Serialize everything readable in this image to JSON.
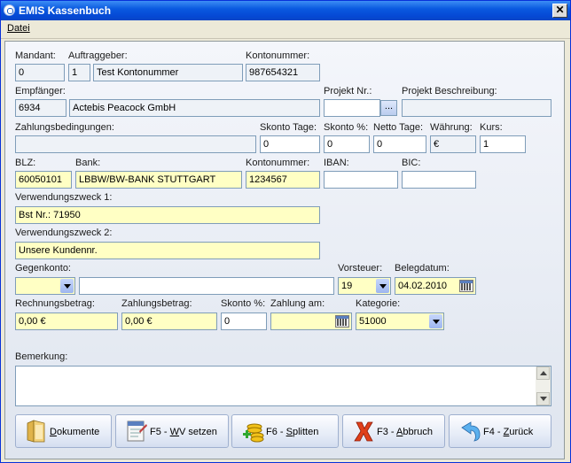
{
  "window": {
    "title": "EMIS Kassenbuch",
    "close": "✕"
  },
  "menu": {
    "datei": "Datei"
  },
  "labels": {
    "mandant": "Mandant:",
    "auftraggeber": "Auftraggeber:",
    "kontonummer1": "Kontonummer:",
    "empfaenger": "Empfänger:",
    "projekt_nr": "Projekt Nr.:",
    "projekt_beschreibung": "Projekt Beschreibung:",
    "zahlungsbedingungen": "Zahlungsbedingungen:",
    "skonto_tage": "Skonto Tage:",
    "skonto_pct": "Skonto %:",
    "netto_tage": "Netto Tage:",
    "waehrung": "Währung:",
    "kurs": "Kurs:",
    "blz": "BLZ:",
    "bank": "Bank:",
    "kontonummer2": "Kontonummer:",
    "iban": "IBAN:",
    "bic": "BIC:",
    "vz1": "Verwendungszweck 1:",
    "vz2": "Verwendungszweck 2:",
    "gegenkonto": "Gegenkonto:",
    "vorsteuer": "Vorsteuer:",
    "belegdatum": "Belegdatum:",
    "rechnungsbetrag": "Rechnungsbetrag:",
    "zahlungsbetrag": "Zahlungsbetrag:",
    "skonto_pct2": "Skonto %:",
    "zahlung_am": "Zahlung am:",
    "kategorie": "Kategorie:",
    "bemerkung": "Bemerkung:"
  },
  "values": {
    "mandant": "0",
    "auftraggeber_nr": "1",
    "auftraggeber_name": "Test Kontonummer",
    "kontonummer1": "987654321",
    "empfaenger_nr": "6934",
    "empfaenger_name": "Actebis Peacock GmbH",
    "projekt_nr": "",
    "projekt_beschreibung": "",
    "zahlungsbedingungen": "",
    "skonto_tage": "0",
    "skonto_pct": "0",
    "netto_tage": "0",
    "waehrung": "€",
    "kurs": "1",
    "blz": "60050101",
    "bank": "LBBW/BW-BANK STUTTGART",
    "kontonummer2": "1234567",
    "iban": "",
    "bic": "",
    "vz1": "Bst Nr.: 71950",
    "vz2": "Unsere Kundennr.",
    "gegenkonto_code": "",
    "gegenkonto_name": "",
    "vorsteuer": "19",
    "belegdatum": "04.02.2010",
    "rechnungsbetrag": "0,00 €",
    "zahlungsbetrag": "0,00 €",
    "skonto_pct2": "0",
    "zahlung_am": "",
    "kategorie": "51000",
    "bemerkung": "",
    "projekt_lookup": "..."
  },
  "buttons": {
    "dokumente": {
      "key": "D",
      "rest": "okumente"
    },
    "wv": {
      "pre": "F5 - ",
      "key": "W",
      "rest": "V setzen"
    },
    "splitten": {
      "pre": "F6 - ",
      "key": "S",
      "rest": "plitten"
    },
    "abbruch": {
      "pre": "F3 - ",
      "key": "A",
      "rest": "bbruch"
    },
    "zurueck": {
      "pre": "F4 - ",
      "key": "Z",
      "rest": "urück"
    }
  },
  "colors": {
    "required_field": "#ffffc4",
    "titlebar": "#0548d4"
  }
}
